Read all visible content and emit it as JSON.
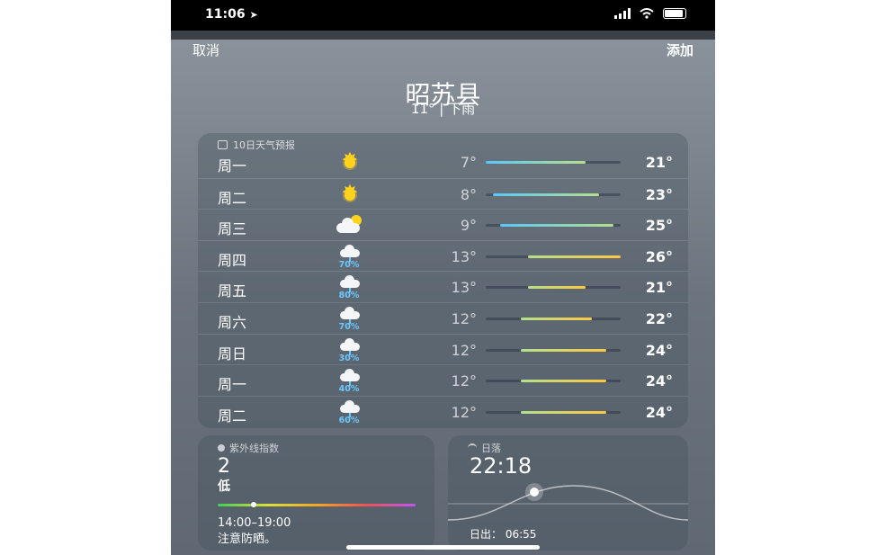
{
  "status": {
    "time": "11:06",
    "location_icon": "location-arrow-icon"
  },
  "nav": {
    "cancel_label": "取消",
    "add_label": "添加"
  },
  "location": {
    "city": "昭苏县",
    "summary": "11° | 下雨"
  },
  "forecast": {
    "header": "10日天气预报",
    "range": [
      7,
      26
    ],
    "days": [
      {
        "day": "周一",
        "icon": "sun-icon",
        "precip": "",
        "low": "7°",
        "high": "21°",
        "low_val": 7,
        "high_val": 21
      },
      {
        "day": "周二",
        "icon": "sun-icon",
        "precip": "",
        "low": "8°",
        "high": "23°",
        "low_val": 8,
        "high_val": 23
      },
      {
        "day": "周三",
        "icon": "partly-cloudy-icon",
        "precip": "",
        "low": "9°",
        "high": "25°",
        "low_val": 9,
        "high_val": 25
      },
      {
        "day": "周四",
        "icon": "rain-icon",
        "precip": "70%",
        "low": "13°",
        "high": "26°",
        "low_val": 13,
        "high_val": 26
      },
      {
        "day": "周五",
        "icon": "rain-icon",
        "precip": "80%",
        "low": "13°",
        "high": "21°",
        "low_val": 13,
        "high_val": 21
      },
      {
        "day": "周六",
        "icon": "rain-icon",
        "precip": "70%",
        "low": "12°",
        "high": "22°",
        "low_val": 12,
        "high_val": 22
      },
      {
        "day": "周日",
        "icon": "rain-icon",
        "precip": "30%",
        "low": "12°",
        "high": "24°",
        "low_val": 12,
        "high_val": 24
      },
      {
        "day": "周一",
        "icon": "rain-icon",
        "precip": "40%",
        "low": "12°",
        "high": "24°",
        "low_val": 12,
        "high_val": 24
      },
      {
        "day": "周二",
        "icon": "rain-icon",
        "precip": "60%",
        "low": "12°",
        "high": "24°",
        "low_val": 12,
        "high_val": 24
      }
    ]
  },
  "uv": {
    "header": "紫外线指数",
    "value": "2",
    "level": "低",
    "index_fraction": 0.18,
    "time_range": "14:00–19:00",
    "advice": "注意防晒。"
  },
  "sunset": {
    "header": "日落",
    "time": "22:18",
    "sunrise": "日出： 06:55"
  },
  "colors": {
    "cool": "#5ac8fa",
    "mid": "#b5e08c",
    "warm": "#ffc83d",
    "precip": "#6cc9ff"
  }
}
